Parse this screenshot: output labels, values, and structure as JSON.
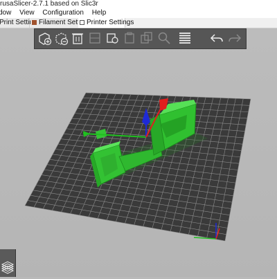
{
  "window": {
    "title": "rusaSlicer-2.7.1 based on Slic3r"
  },
  "menu": {
    "items": [
      "dow",
      "View",
      "Configuration",
      "Help"
    ]
  },
  "tabs": [
    {
      "label": "Print Settings",
      "icon": "gear-icon",
      "color": "#ffffff"
    },
    {
      "label": "Filament Settings",
      "icon": "filament-spool-icon",
      "color": "#a0522d"
    },
    {
      "label": "Printer Settings",
      "icon": "printer-icon",
      "color": "#ffffff"
    }
  ],
  "toolbar": {
    "buttons": [
      {
        "name": "add-object-button",
        "icon": "add-cube-icon",
        "enabled": true
      },
      {
        "name": "delete-object-button",
        "icon": "remove-cube-icon",
        "enabled": true
      },
      {
        "name": "delete-all-button",
        "icon": "trash-icon",
        "enabled": true
      },
      {
        "name": "arrange-button",
        "icon": "arrange-icon",
        "enabled": false
      },
      {
        "name": "copy-button",
        "icon": "copy-icon",
        "enabled": true
      },
      {
        "name": "paste-button",
        "icon": "paste-icon",
        "enabled": false
      },
      {
        "name": "search-button",
        "icon": "search-icon",
        "enabled": false
      },
      {
        "name": "layers-editing-button",
        "icon": "layers-icon",
        "enabled": true
      },
      {
        "name": "undo-button",
        "icon": "undo-icon",
        "enabled": true
      },
      {
        "name": "redo-button",
        "icon": "redo-icon",
        "enabled": false
      }
    ]
  },
  "scene": {
    "bed_color": "#3c3c3c",
    "grid_color": "#8a8a8a",
    "model_color": "#3cd63c",
    "axis_colors": {
      "x": "#e01e1e",
      "y": "#1fbf1f",
      "z": "#1e2ad6"
    }
  }
}
